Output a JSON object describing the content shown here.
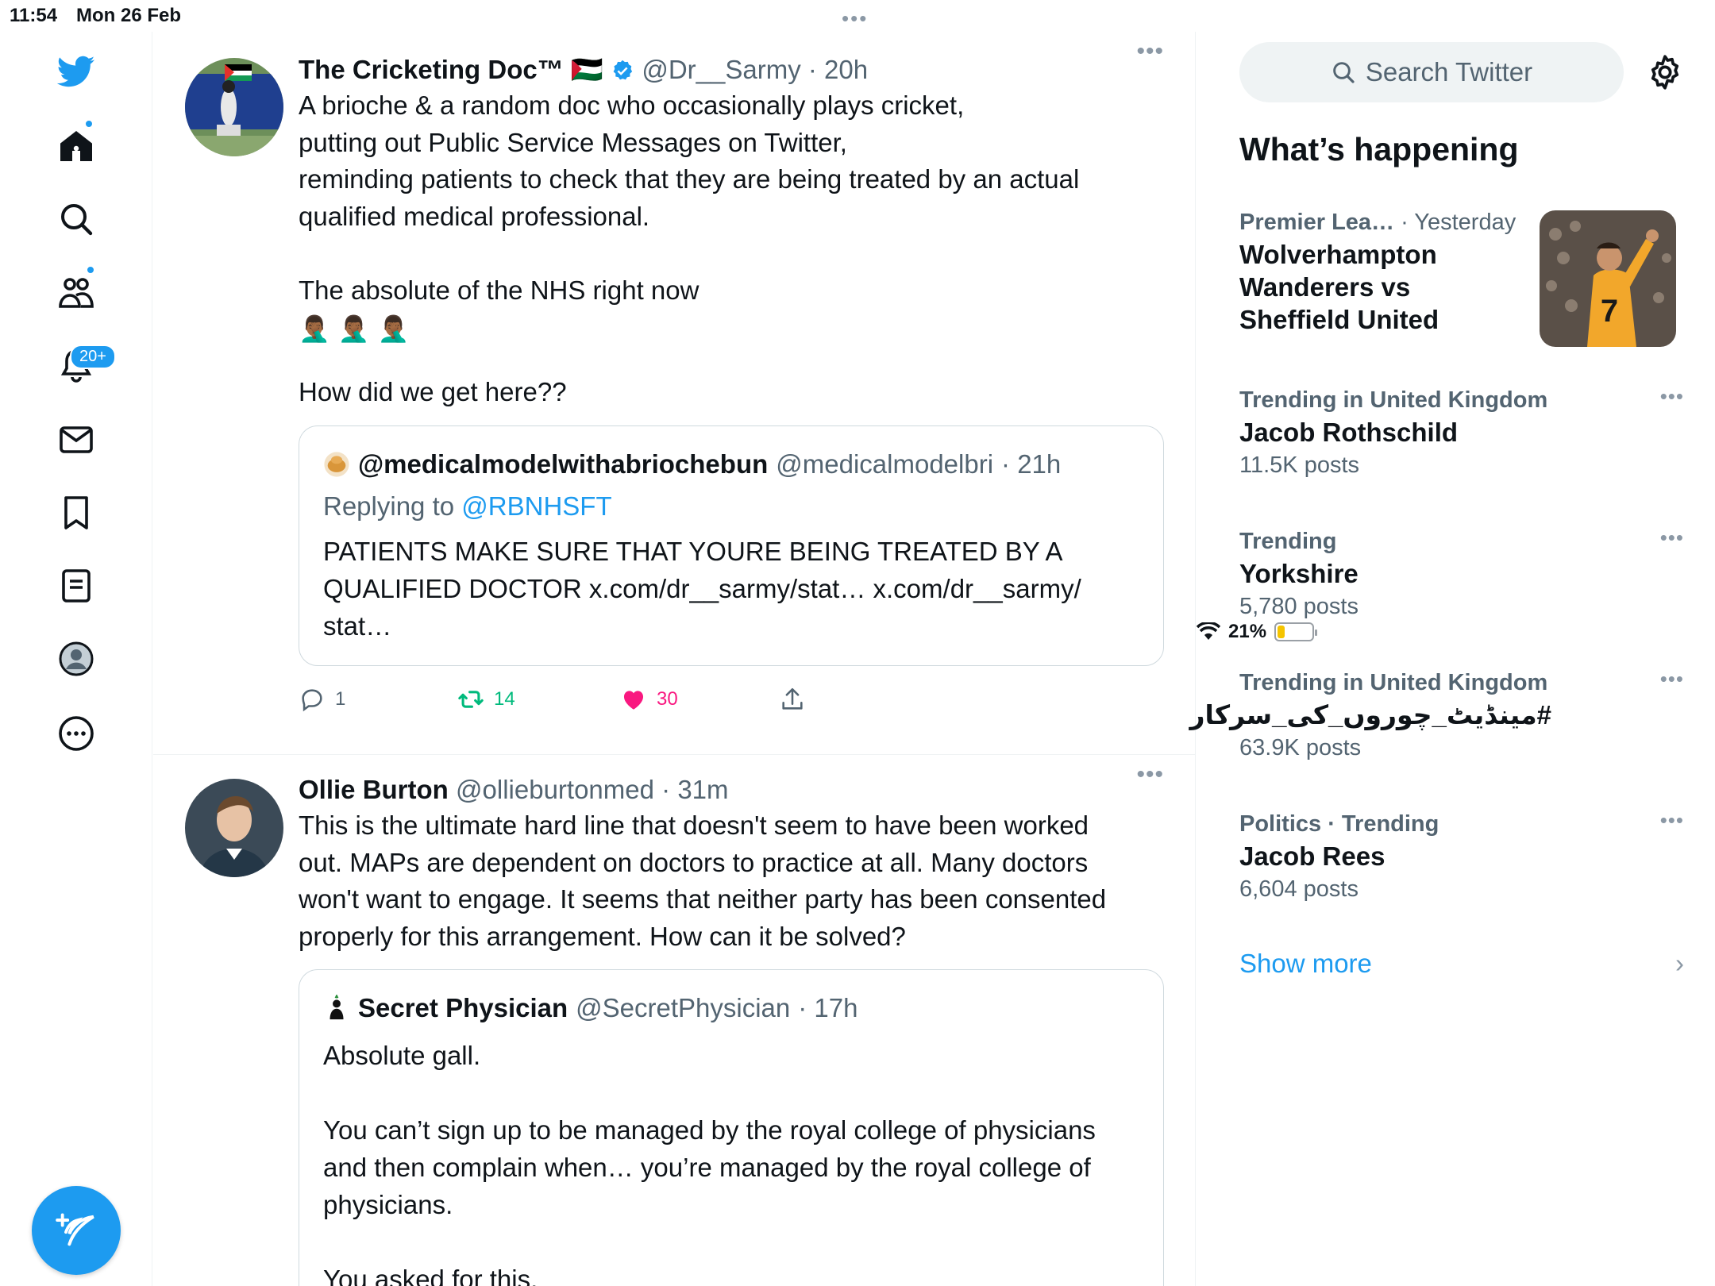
{
  "status_bar": {
    "time": "11:54",
    "date": "Mon 26 Feb",
    "battery": "21%",
    "battery_level": 0.21
  },
  "nav": {
    "items": [
      "twitter-logo",
      "home",
      "search",
      "communities",
      "notifications",
      "messages",
      "bookmarks",
      "lists",
      "profile",
      "more"
    ],
    "notifications_badge": "20+"
  },
  "tweets": [
    {
      "name": "The Cricketing Doc™",
      "flag": "🇵🇸",
      "handle": "@Dr__Sarmy",
      "time": "· 20h",
      "text": "A brioche & a random doc who occasionally plays cricket,\nputting out Public Service Messages on Twitter,\nreminding patients to check that they are being treated by an actual\nqualified medical professional.\n\nThe absolute of the NHS right now",
      "emoji": [
        "🤦🏾‍♂️",
        "🤦🏾‍♂️",
        "🤦🏾‍♂️"
      ],
      "text2": "How did we get here??",
      "quote": {
        "name": "@medicalmodelwithabriochebun",
        "handle": "@medicalmodelbri",
        "time": "· 21h",
        "reply_prefix": "Replying to",
        "reply_to": "@RBNHSFT",
        "text": "PATIENTS MAKE SURE THAT YOURE BEING TREATED BY A\nQUALIFIED DOCTOR x.com/dr__sarmy/stat… x.com/dr__sarmy/\nstat…"
      },
      "stats": {
        "replies": "1",
        "retweets": "14",
        "likes": "30"
      }
    },
    {
      "name": "Ollie Burton",
      "handle": "@ollieburtonmed",
      "time": "· 31m",
      "text": "This is the ultimate hard line that doesn't seem to have been worked\nout. MAPs are dependent on doctors to practice at all. Many doctors\nwon't want to engage. It seems that neither party has been consented\nproperly for this arrangement. How can it be solved?",
      "quote": {
        "name": "Secret Physician",
        "handle": "@SecretPhysician",
        "time": "· 17h",
        "text": "Absolute gall.\n\nYou can’t sign up to be managed by the royal college of physicians\nand then complain when… you’re managed by the royal college of\nphysicians.\n\nYou asked for this."
      }
    }
  ],
  "sidebar": {
    "search_placeholder": "Search Twitter",
    "whats_happening": "What’s happening",
    "trends": [
      {
        "category": "Premier Lea…",
        "when": "· Yesterday",
        "title": "Wolverhampton\nWanderers vs\nSheffield United"
      },
      {
        "meta": "Trending in United Kingdom",
        "title": "Jacob Rothschild",
        "posts": "11.5K posts"
      },
      {
        "meta": "Trending",
        "title": "Yorkshire",
        "posts": "5,780 posts"
      },
      {
        "meta": "Trending in United Kingdom",
        "title": "#مینڈیٹ_چوروں_کی_سرکار",
        "posts": "63.9K posts"
      },
      {
        "meta": "Politics · Trending",
        "title": "Jacob Rees",
        "posts": "6,604 posts"
      }
    ],
    "show_more": "Show more"
  },
  "colors": {
    "accent": "#1d9bf0",
    "retweet": "#00ba7c",
    "like": "#f91880",
    "secondary": "#536471"
  }
}
